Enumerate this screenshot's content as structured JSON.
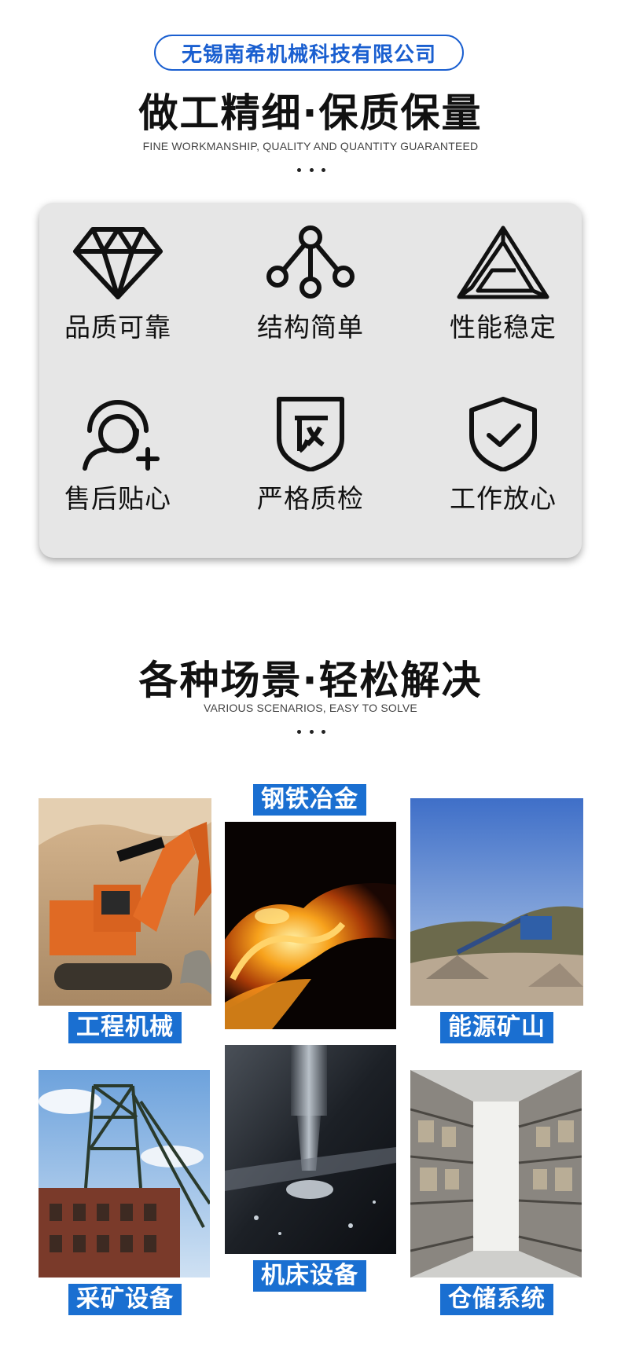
{
  "header": {
    "company": "无锡南希机械科技有限公司",
    "title": "做工精细·保质保量",
    "subtitle": "FINE WORKMANSHIP, QUALITY AND QUANTITY GUARANTEED"
  },
  "features": [
    {
      "label": "品质可靠",
      "icon": "diamond-icon"
    },
    {
      "label": "结构简单",
      "icon": "structure-icon"
    },
    {
      "label": "性能稳定",
      "icon": "penrose-triangle-icon"
    },
    {
      "label": "售后贴心",
      "icon": "customer-service-icon"
    },
    {
      "label": "严格质检",
      "icon": "quality-shield-icon"
    },
    {
      "label": "工作放心",
      "icon": "check-shield-icon"
    }
  ],
  "scenarios_header": {
    "title": "各种场景·轻松解决",
    "subtitle": "VARIOUS SCENARIOS, EASY TO SOLVE"
  },
  "scenarios": [
    {
      "label": "工程机械",
      "image": "excavator-photo"
    },
    {
      "label": "钢铁冶金",
      "image": "molten-steel-photo"
    },
    {
      "label": "能源矿山",
      "image": "quarry-conveyor-photo"
    },
    {
      "label": "采矿设备",
      "image": "mine-headframe-photo"
    },
    {
      "label": "机床设备",
      "image": "cnc-milling-photo"
    },
    {
      "label": "仓储系统",
      "image": "warehouse-shelves-photo"
    }
  ],
  "colors": {
    "accent": "#1a6fd1",
    "card": "#e6e6e6"
  }
}
